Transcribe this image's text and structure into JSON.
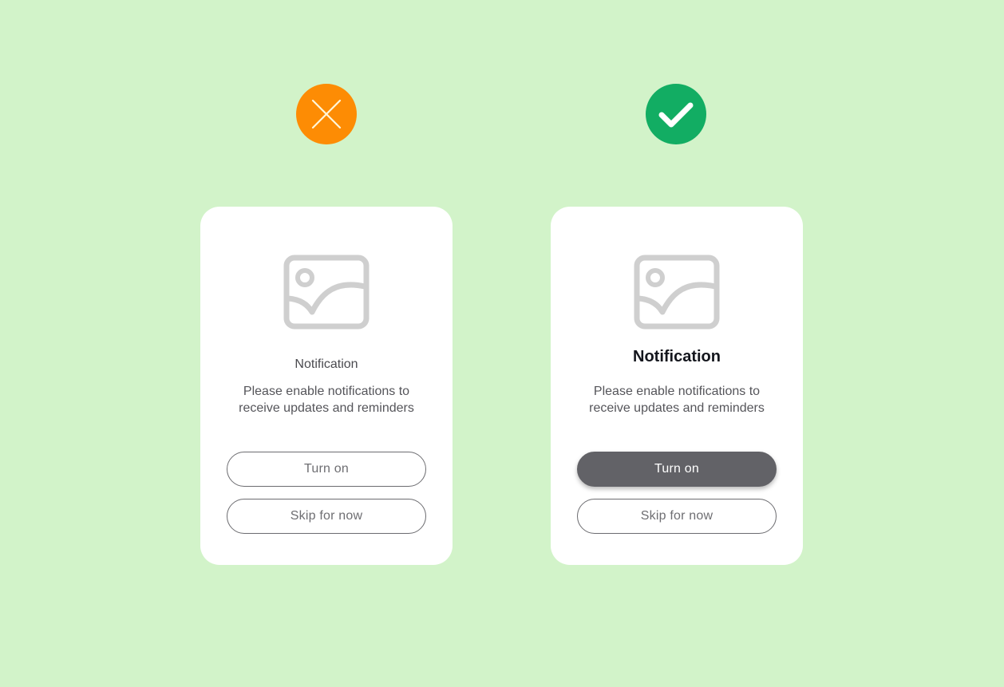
{
  "colors": {
    "background": "#d2f3c9",
    "bad_badge": "#fd8c04",
    "good_badge": "#12ad63",
    "filled_button": "#626267",
    "placeholder_icon": "#cfcfcf"
  },
  "examples": [
    {
      "verdict_icon": "x-icon",
      "image_icon": "image-placeholder-icon",
      "title": "Notification",
      "body": "Please enable notifications to receive updates and reminders",
      "primary_button": "Turn on",
      "secondary_button": "Skip for now"
    },
    {
      "verdict_icon": "checkmark-icon",
      "image_icon": "image-placeholder-icon",
      "title": "Notification",
      "body": "Please enable notifications to receive updates and reminders",
      "primary_button": "Turn on",
      "secondary_button": "Skip for now"
    }
  ]
}
